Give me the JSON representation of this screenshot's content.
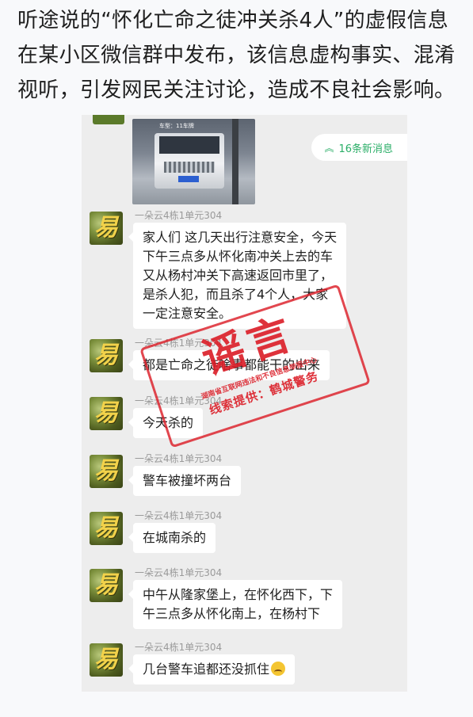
{
  "article": {
    "lines": [
      "听途说的“怀化亡命之徒冲关杀4人”的虚假信息",
      "在某小区微信群中发布，该信息虚构事实、混淆",
      "视听，引发网民关注讨论，造成不良社会影响。"
    ]
  },
  "chat": {
    "new_messages_label": "16条新消息",
    "image_overlay_text": "车型：11车牌",
    "messages": [
      {
        "sender": "一朵云4栋1单元304",
        "lines": [
          "家人们 这几天出行注意安全，今天",
          "下午三点多从怀化南冲关上去的车",
          "又从杨村冲关下高速返回市里了，",
          "是杀人犯，而且杀了4个人，大家",
          "一定注意安全。"
        ]
      },
      {
        "sender": "一朵云4栋1单元304",
        "lines": [
          "都是亡命之徒啥事都能干的出来"
        ]
      },
      {
        "sender": "一朵云4栋1单元304",
        "lines": [
          "今天杀的"
        ]
      },
      {
        "sender": "一朵云4栋1单元304",
        "lines": [
          "警车被撞坏两台"
        ]
      },
      {
        "sender": "一朵云4栋1单元304",
        "lines": [
          "在城南杀的"
        ]
      },
      {
        "sender": "一朵云4栋1单元304",
        "lines": [
          "中午从隆家堡上，在怀化西下，下",
          "午三点多从怀化南上，在杨村下"
        ]
      },
      {
        "sender": "一朵云4栋1单元304",
        "lines": [
          "几台警车追都还没抓住"
        ]
      }
    ]
  },
  "stamp": {
    "title": "谣言",
    "line1": "湖南省互联网违法和不良信息举报中心",
    "line2": "线索提供：鹤城警务",
    "color": "#da1c26"
  },
  "colors": {
    "chat_bg": "#ededed",
    "new_msg_green": "#2aae67"
  }
}
